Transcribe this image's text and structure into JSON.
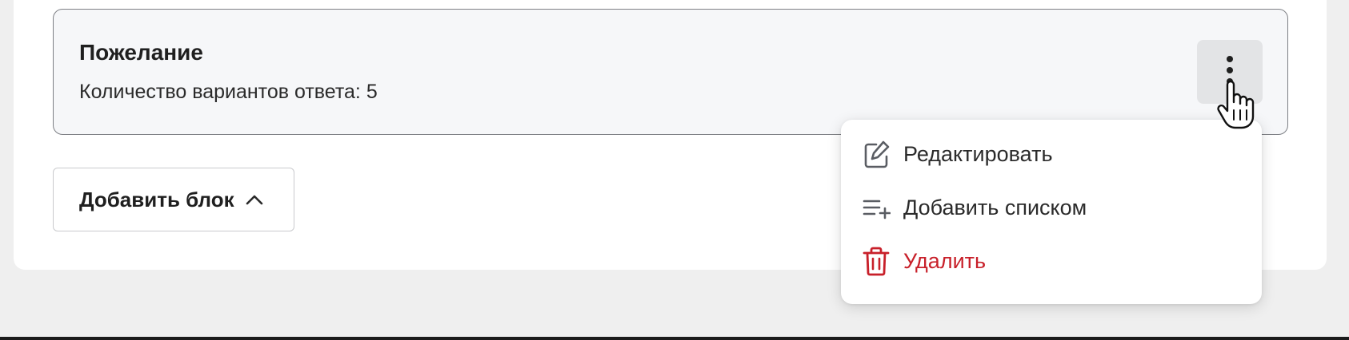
{
  "block": {
    "title": "Пожелание",
    "subtitle": "Количество вариантов ответа: 5"
  },
  "actions": {
    "add_block_label": "Добавить блок"
  },
  "menu": {
    "items": [
      {
        "label": "Редактировать",
        "icon": "edit-icon",
        "danger": false
      },
      {
        "label": "Добавить списком",
        "icon": "list-add-icon",
        "danger": false
      },
      {
        "label": "Удалить",
        "icon": "trash-icon",
        "danger": true
      }
    ]
  },
  "colors": {
    "danger": "#c8202a",
    "card_background": "#f6f7f9",
    "page_background": "#efefef"
  }
}
